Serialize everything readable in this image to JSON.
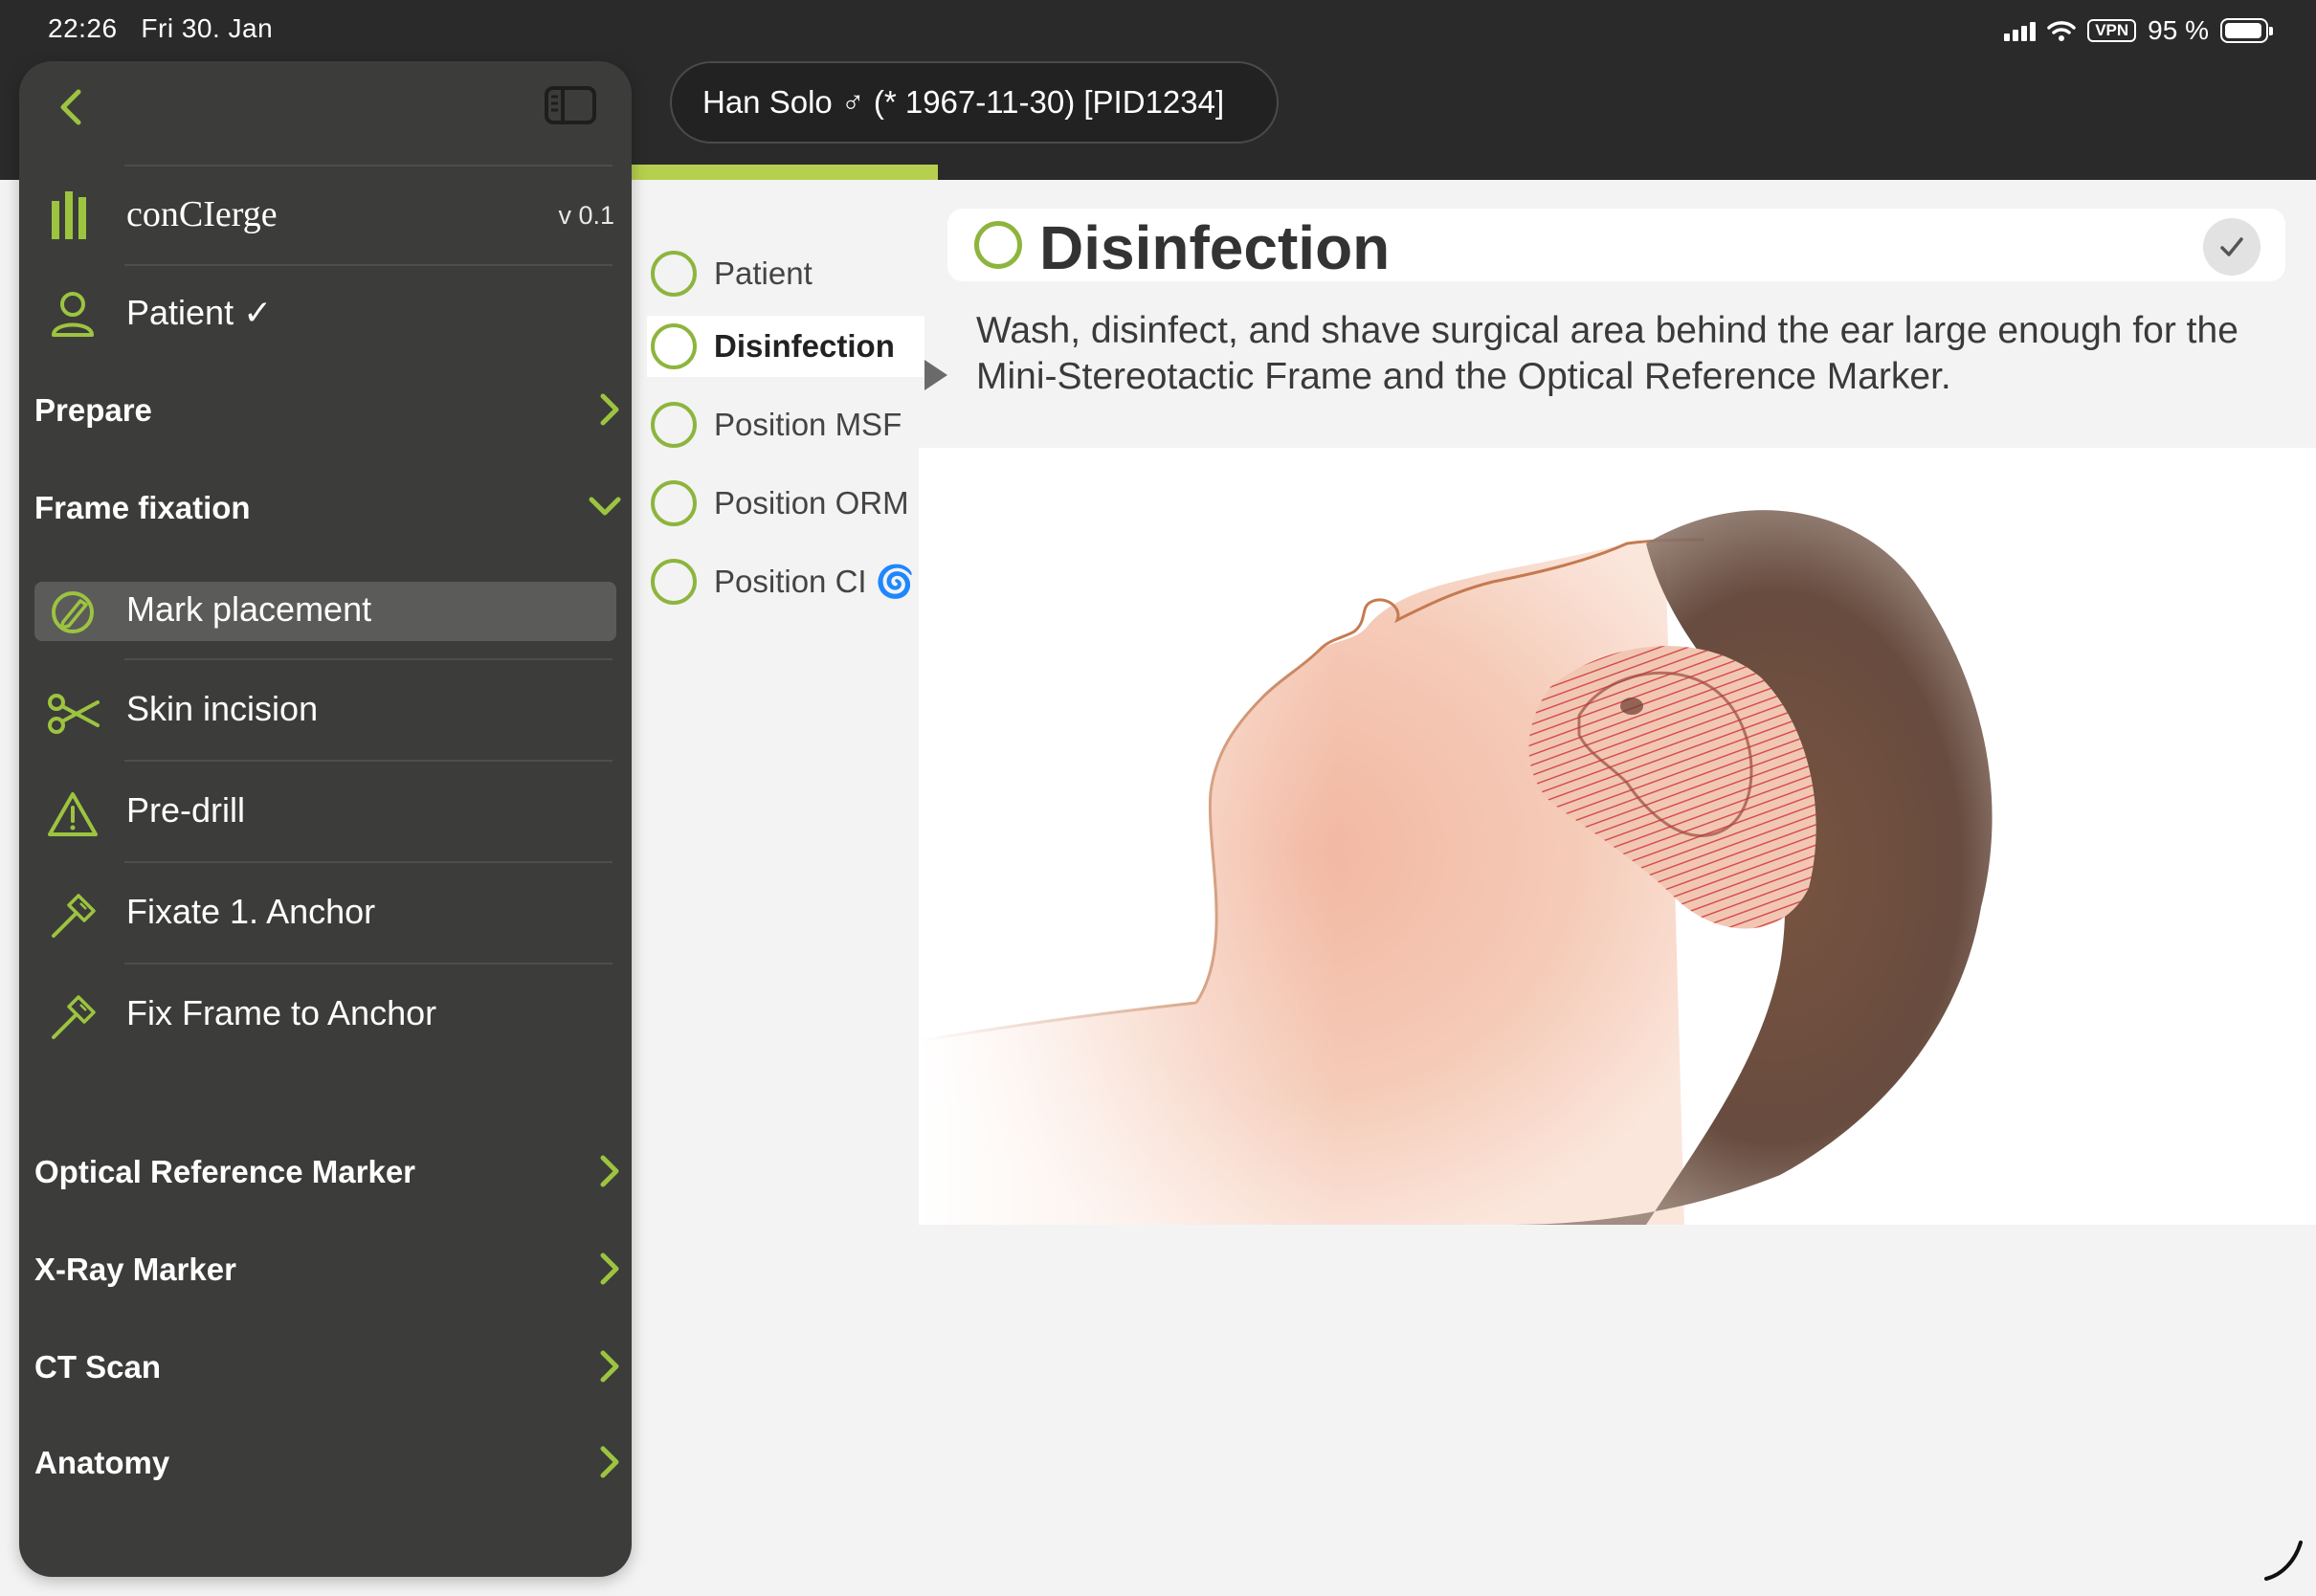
{
  "status_bar": {
    "time": "22:26",
    "date": "Fri 30. Jan",
    "vpn": "VPN",
    "battery": "95 %",
    "battery_level": 0.95
  },
  "patient_header": {
    "label": "Han Solo ♂ (* 1967-11-30) [PID1234]"
  },
  "progress": {
    "accent_color": "#b6cf4f"
  },
  "sidebar": {
    "back_icon": "chevron-left-icon",
    "toggle_icon": "sidebar-toggle-icon",
    "app_name": "conCIerge",
    "version": "v 0.1",
    "patient_label": "Patient ✓",
    "sections": [
      {
        "label": "Prepare",
        "state": "collapsed"
      },
      {
        "label": "Frame fixation",
        "state": "expanded"
      },
      {
        "label": "Optical Reference Marker",
        "state": "collapsed"
      },
      {
        "label": "X-Ray Marker",
        "state": "collapsed"
      },
      {
        "label": "CT Scan",
        "state": "collapsed"
      },
      {
        "label": "Anatomy",
        "state": "collapsed"
      }
    ],
    "frame_fixation_items": [
      {
        "label": "Mark placement",
        "icon": "marker-target-icon",
        "active": true
      },
      {
        "label": "Skin incision",
        "icon": "scissors-icon",
        "active": false
      },
      {
        "label": "Pre-drill",
        "icon": "warning-triangle-icon",
        "active": false
      },
      {
        "label": "Fixate 1. Anchor",
        "icon": "screwdriver-icon",
        "active": false
      },
      {
        "label": "Fix Frame to Anchor",
        "icon": "screwdriver-icon",
        "active": false
      }
    ],
    "accent_color": "#9cc43f"
  },
  "steps": [
    {
      "label": "Patient",
      "active": false
    },
    {
      "label": "Disinfection",
      "active": true
    },
    {
      "label": "Position MSF",
      "active": false
    },
    {
      "label": "Position ORM",
      "active": false
    },
    {
      "label": "Position CI 🌀",
      "active": false
    }
  ],
  "content": {
    "title": "Disinfection",
    "description": "Wash, disinfect, and shave surgical area behind the ear large enough for the Mini-Stereotactic Frame and the Optical Reference Marker.",
    "check_icon": "checkmark-icon",
    "illustration": "head-profile-ear-shaved-area-illustration"
  }
}
